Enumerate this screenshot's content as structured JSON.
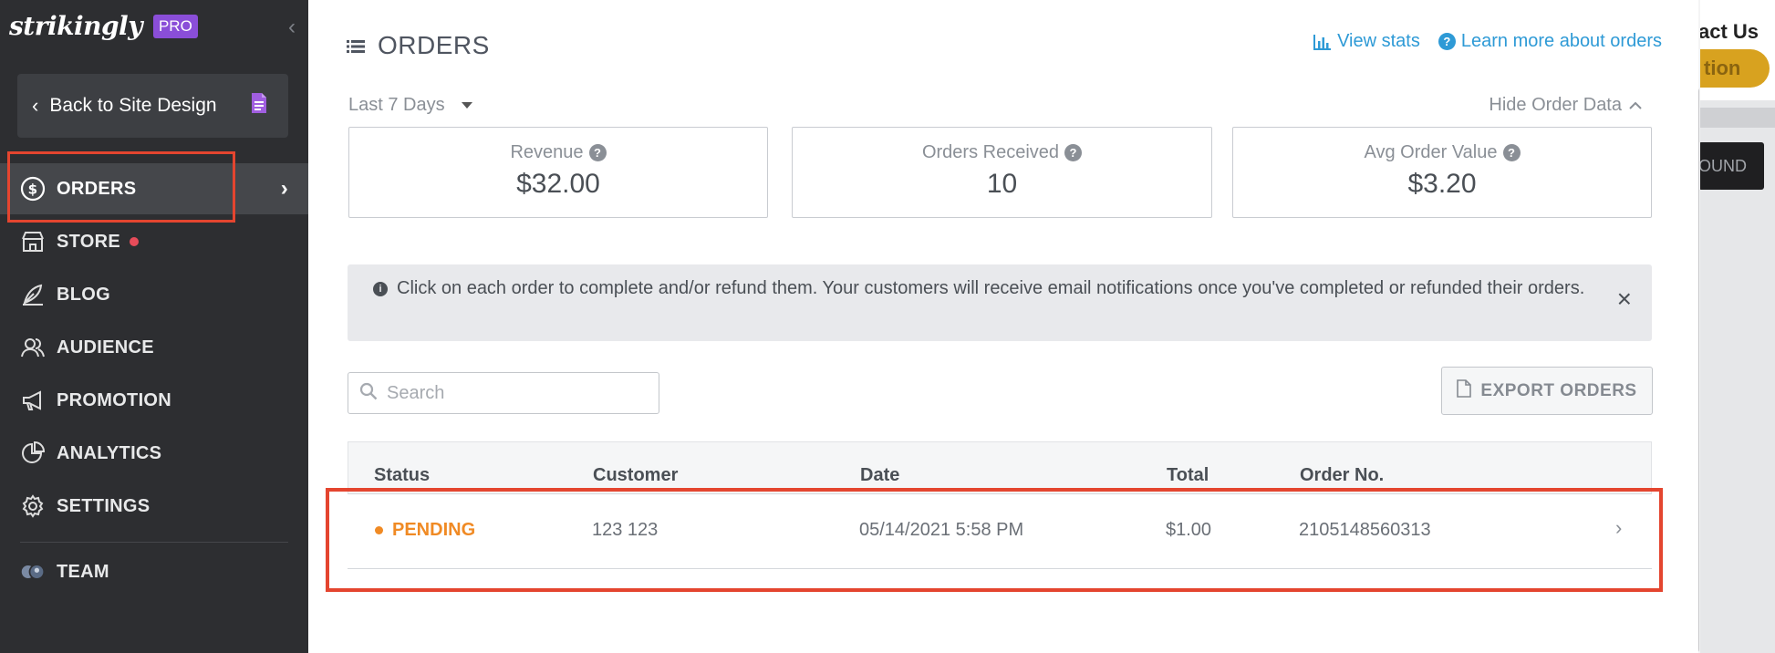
{
  "brand": {
    "logo": "strikingly",
    "badge": "PRO"
  },
  "sidebar": {
    "back_label": "Back to Site Design",
    "items": [
      {
        "label": "ORDERS",
        "icon": "dollar-circle-icon",
        "active": true
      },
      {
        "label": "STORE",
        "icon": "store-icon",
        "has_dot": true
      },
      {
        "label": "BLOG",
        "icon": "feather-icon"
      },
      {
        "label": "AUDIENCE",
        "icon": "people-icon"
      },
      {
        "label": "PROMOTION",
        "icon": "megaphone-icon"
      },
      {
        "label": "ANALYTICS",
        "icon": "pie-chart-icon"
      },
      {
        "label": "SETTINGS",
        "icon": "gear-icon"
      },
      {
        "label": "TEAM",
        "icon": "team-avatars-icon"
      }
    ]
  },
  "header": {
    "title": "ORDERS",
    "view_stats": "View stats",
    "learn_more": "Learn more about orders"
  },
  "filters": {
    "date_range": "Last 7 Days",
    "hide_data": "Hide Order Data"
  },
  "stats": [
    {
      "label": "Revenue",
      "value": "$32.00"
    },
    {
      "label": "Orders Received",
      "value": "10"
    },
    {
      "label": "Avg Order Value",
      "value": "$3.20"
    }
  ],
  "notice": {
    "text": "Click on each order to complete and/or refund them. Your customers will receive email notifications once you've completed or refunded their orders."
  },
  "search": {
    "placeholder": "Search",
    "value": ""
  },
  "export_label": "EXPORT ORDERS",
  "table": {
    "columns": [
      "Status",
      "Customer",
      "Date",
      "Total",
      "Order No."
    ],
    "rows": [
      {
        "status": "PENDING",
        "customer": "123 123",
        "date": "05/14/2021 5:58 PM",
        "total": "$1.00",
        "order_no": "2105148560313"
      }
    ]
  },
  "background": {
    "contact_text": "act Us",
    "pill_text": "tion",
    "dark_button_text": "OUND"
  },
  "colors": {
    "sidebar_bg": "#2d2e31",
    "link": "#2e9ad6",
    "pending": "#f08a24",
    "highlight": "#e4452f",
    "pro_badge": "#8a4ed8"
  }
}
